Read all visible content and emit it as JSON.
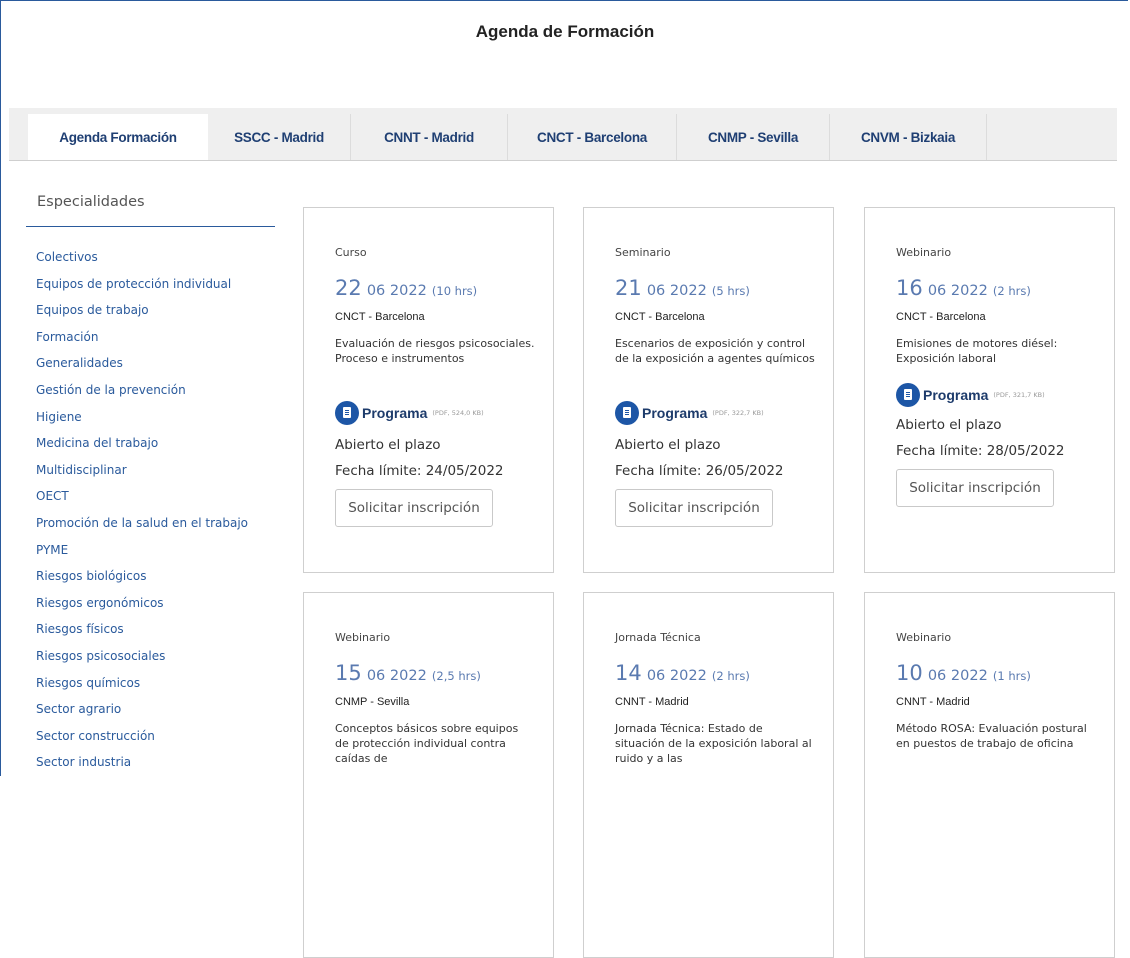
{
  "header": {
    "title": "Agenda de Formación"
  },
  "tabs": [
    {
      "label": "Agenda Formación",
      "active": true
    },
    {
      "label": "SSCC - Madrid",
      "active": false
    },
    {
      "label": "CNNT - Madrid",
      "active": false
    },
    {
      "label": "CNCT - Barcelona",
      "active": false
    },
    {
      "label": "CNMP - Sevilla",
      "active": false
    },
    {
      "label": "CNVM - Bizkaia",
      "active": false
    }
  ],
  "sidebar": {
    "title": "Especialidades",
    "items": [
      "Colectivos",
      "Equipos de protección individual",
      "Equipos de trabajo",
      "Formación",
      "Generalidades",
      "Gestión de la prevención",
      "Higiene",
      "Medicina del trabajo",
      "Multidisciplinar",
      "OECT",
      "Promoción de la salud en el trabajo",
      "PYME",
      "Riesgos biológicos",
      "Riesgos ergonómicos",
      "Riesgos físicos",
      "Riesgos psicosociales",
      "Riesgos químicos",
      "Sector agrario",
      "Sector construcción",
      "Sector industria"
    ]
  },
  "events": [
    {
      "type": "Curso",
      "day": "22",
      "month_year": "06 2022",
      "duration": "(10 hrs)",
      "center": "CNCT - Barcelona",
      "description": "Evaluación de riesgos psicosociales. Proceso e instrumentos",
      "program_label": "Programa",
      "program_info": "(PDF, 524,0 KB)",
      "status": "Abierto el plazo",
      "deadline": "Fecha límite: 24/05/2022",
      "button": "Solicitar inscripción"
    },
    {
      "type": "Seminario",
      "day": "21",
      "month_year": "06 2022",
      "duration": "(5 hrs)",
      "center": "CNCT - Barcelona",
      "description": "Escenarios de exposición y control de la exposición a agentes químicos",
      "program_label": "Programa",
      "program_info": "(PDF, 322,7 KB)",
      "status": "Abierto el plazo",
      "deadline": "Fecha límite: 26/05/2022",
      "button": "Solicitar inscripción"
    },
    {
      "type": "Webinario",
      "day": "16",
      "month_year": "06 2022",
      "duration": "(2 hrs)",
      "center": "CNCT - Barcelona",
      "description": "Emisiones de motores diésel: Exposición laboral",
      "program_label": "Programa",
      "program_info": "(PDF, 321,7 KB)",
      "status": "Abierto el plazo",
      "deadline": "Fecha límite: 28/05/2022",
      "button": "Solicitar inscripción"
    },
    {
      "type": "Webinario",
      "day": "15",
      "month_year": "06 2022",
      "duration": "(2,5 hrs)",
      "center": "CNMP - Sevilla",
      "description": "Conceptos básicos sobre equipos de protección individual contra caídas de"
    },
    {
      "type": "Jornada Técnica",
      "day": "14",
      "month_year": "06 2022",
      "duration": "(2 hrs)",
      "center": "CNNT - Madrid",
      "description": "Jornada Técnica: Estado de situación de la exposición laboral al ruido y a las"
    },
    {
      "type": "Webinario",
      "day": "10",
      "month_year": "06 2022",
      "duration": "(1 hrs)",
      "center": "CNNT - Madrid",
      "description": "Método ROSA: Evaluación postural en puestos de trabajo de oficina"
    }
  ]
}
